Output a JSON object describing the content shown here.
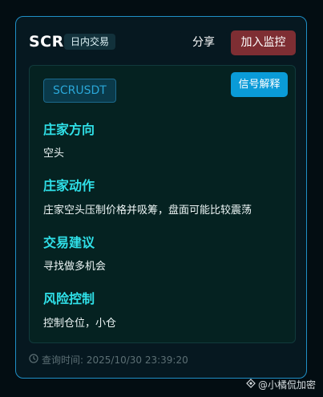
{
  "header": {
    "ticker": "SCR",
    "tag": "日内交易",
    "share_label": "分享",
    "monitor_label": "加入监控"
  },
  "panel": {
    "symbol": "SCRUSDT",
    "signal_button": "信号解释",
    "sections": [
      {
        "title": "庄家方向",
        "text": "空头"
      },
      {
        "title": "庄家动作",
        "text": "庄家空头压制价格并吸筹，盘面可能比较震荡"
      },
      {
        "title": "交易建议",
        "text": "寻找做多机会"
      },
      {
        "title": "风险控制",
        "text": "控制仓位，小仓"
      }
    ]
  },
  "footer": {
    "query_time": "查询时间: 2025/10/30 23:39:20"
  },
  "watermark": {
    "text": "@小橘侃加密"
  },
  "colors": {
    "card_border": "#1f8fc6",
    "section_title": "#2fe0e8",
    "monitor_button": "#7e2e33",
    "signal_button": "#0a9bd8"
  }
}
